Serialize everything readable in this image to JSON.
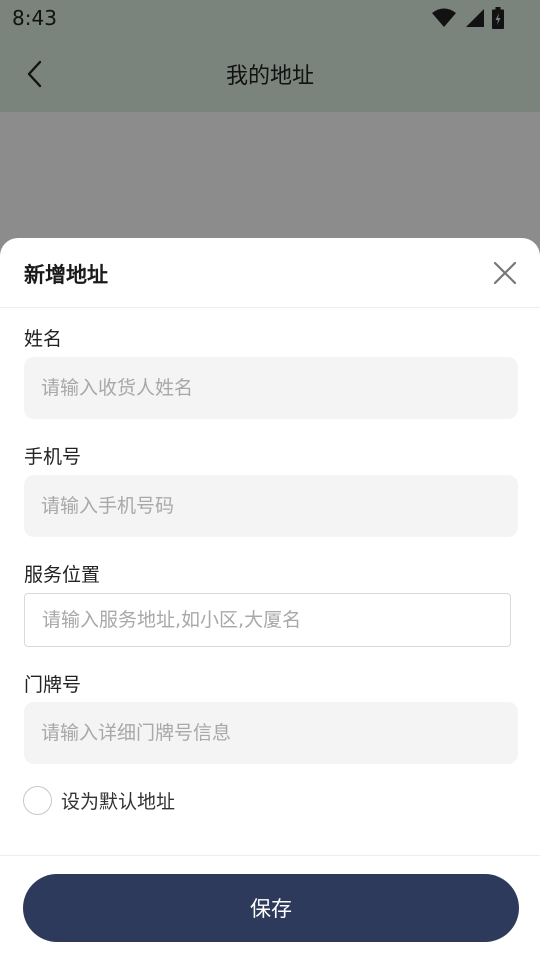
{
  "status_bar": {
    "time": "8:43"
  },
  "nav": {
    "title": "我的地址"
  },
  "sheet": {
    "title": "新增地址",
    "fields": {
      "name": {
        "label": "姓名",
        "placeholder": "请输入收货人姓名",
        "value": ""
      },
      "phone": {
        "label": "手机号",
        "placeholder": "请输入手机号码",
        "value": ""
      },
      "location": {
        "label": "服务位置",
        "placeholder": "请输入服务地址,如小区,大厦名",
        "value": ""
      },
      "door": {
        "label": "门牌号",
        "placeholder": "请输入详细门牌号信息",
        "value": ""
      }
    },
    "default_label": "设为默认地址",
    "save_label": "保存"
  },
  "colors": {
    "accent": "#2e3a5c",
    "nav_background": "#dfeee2",
    "input_background": "#f4f4f4"
  },
  "icons": {
    "back": "chevron-left-icon",
    "close": "close-icon",
    "wifi": "wifi-icon",
    "signal": "signal-icon",
    "battery": "battery-icon"
  }
}
